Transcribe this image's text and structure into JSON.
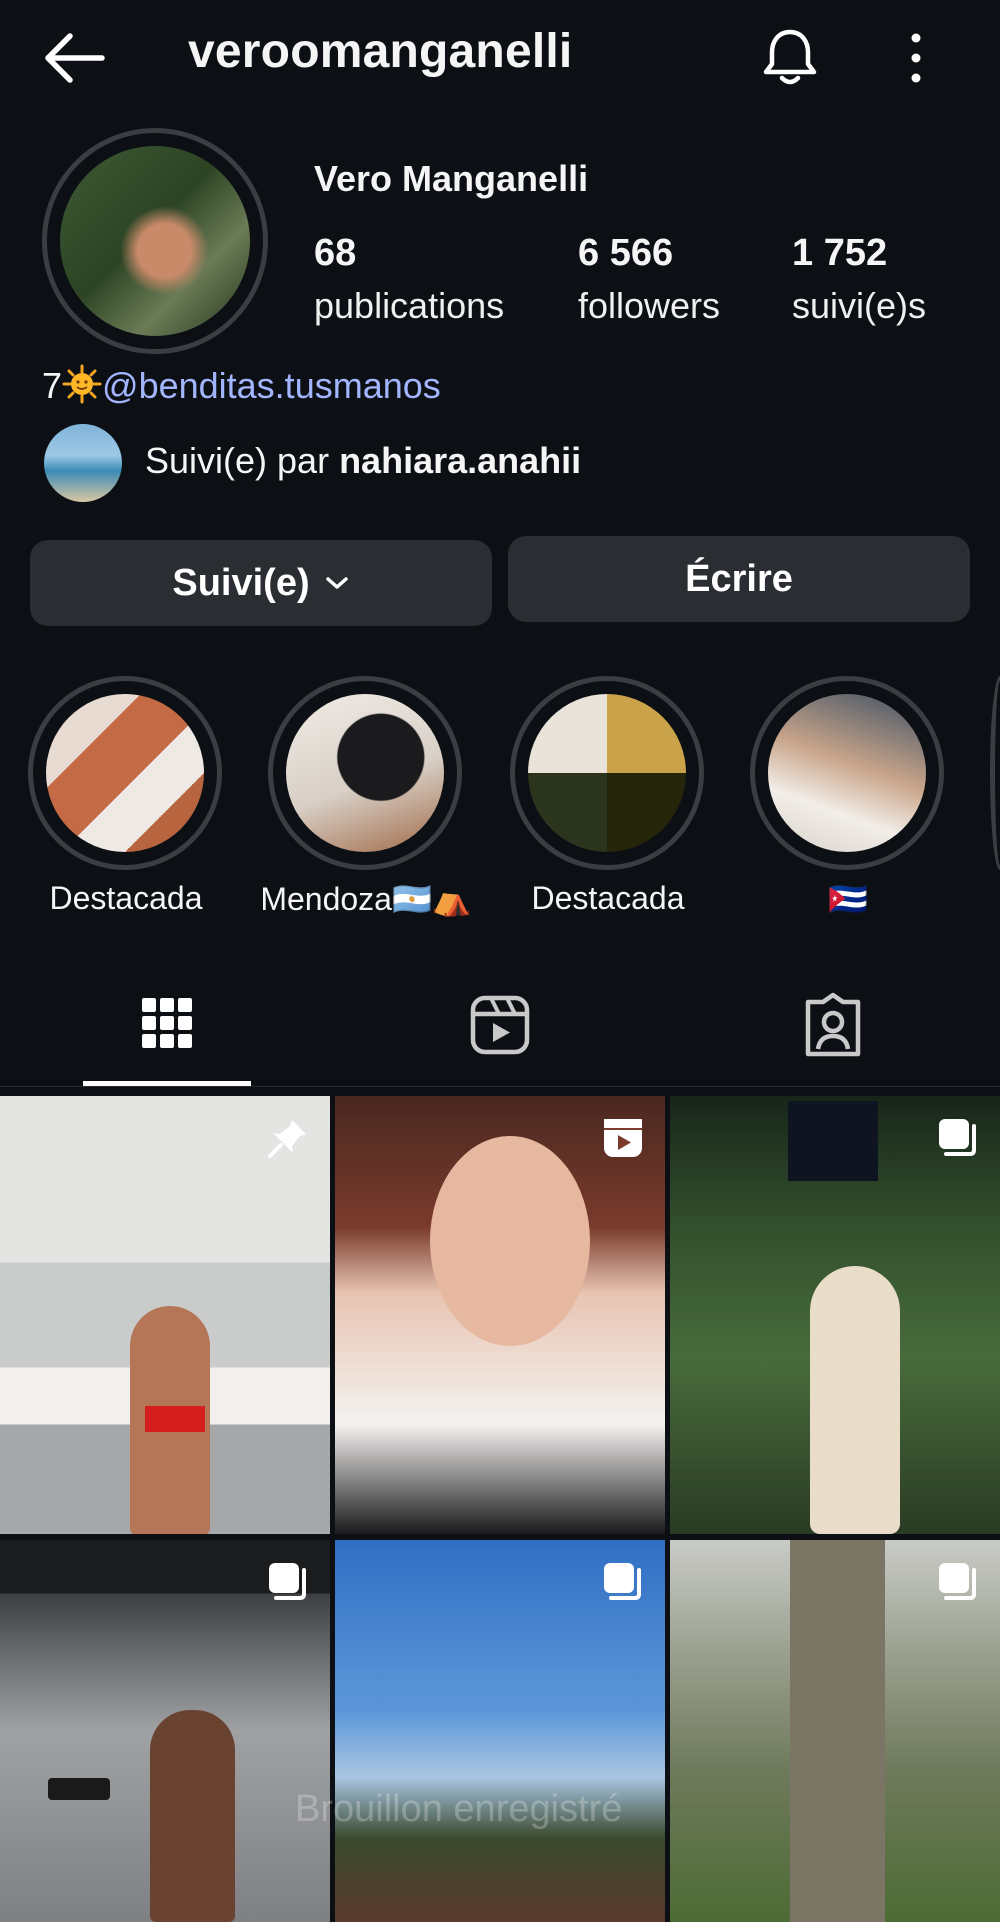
{
  "header": {
    "username": "veroomanganelli",
    "back_icon": "arrow-left-icon",
    "bell_icon": "bell-icon",
    "more_icon": "more-vertical-icon"
  },
  "profile": {
    "full_name": "Vero Manganelli",
    "stats": [
      {
        "value": "68",
        "label": "publications"
      },
      {
        "value": "6 566",
        "label": "followers"
      },
      {
        "value": "1 752",
        "label": "suivi(e)s"
      }
    ],
    "bio_prefix": "7",
    "bio_link": "@benditas.tusmanos",
    "followed_by_prefix": "Suivi(e) par ",
    "followed_by_user": "nahiara.anahii"
  },
  "actions": {
    "follow_label": "Suivi(e)",
    "message_label": "Écrire"
  },
  "highlights": [
    {
      "label": "Destacada"
    },
    {
      "label": "Mendoza🇦🇷⛺"
    },
    {
      "label": "Destacada"
    },
    {
      "label": "🇨🇺"
    }
  ],
  "tabs": [
    {
      "name": "grid",
      "icon": "grid-icon",
      "active": true
    },
    {
      "name": "reels",
      "icon": "reels-icon",
      "active": false
    },
    {
      "name": "tagged",
      "icon": "tagged-user-icon",
      "active": false
    }
  ],
  "posts": [
    {
      "badge": "pin-icon"
    },
    {
      "badge": "reel-icon"
    },
    {
      "badge": "carousel-icon"
    },
    {
      "badge": "carousel-icon"
    },
    {
      "badge": "carousel-icon"
    },
    {
      "badge": "carousel-icon"
    }
  ],
  "watermark": "Brouillon enregistré",
  "colors": {
    "background": "#0c1014",
    "link": "#a3b5ff",
    "button": "#2a2d31"
  }
}
